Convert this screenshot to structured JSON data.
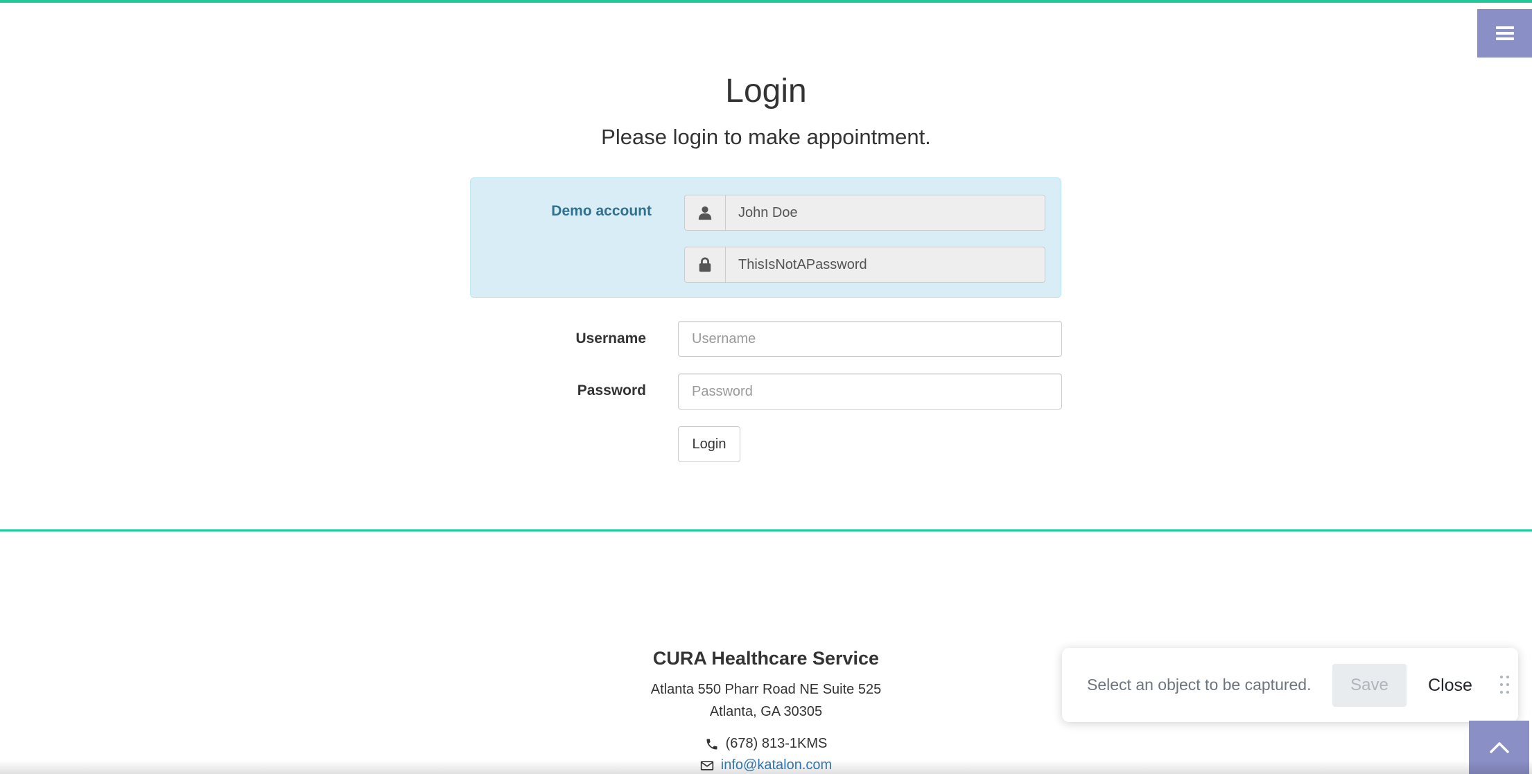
{
  "header": {
    "menu_icon": "bars-icon"
  },
  "login": {
    "title": "Login",
    "subtitle": "Please login to make appointment."
  },
  "demo": {
    "label": "Demo account",
    "username_icon": "user-icon",
    "username_value": "John Doe",
    "password_icon": "lock-icon",
    "password_value": "ThisIsNotAPassword"
  },
  "form": {
    "username_label": "Username",
    "username_placeholder": "Username",
    "password_label": "Password",
    "password_placeholder": "Password",
    "login_button": "Login"
  },
  "footer": {
    "company": "CURA Healthcare Service",
    "address_line1": "Atlanta 550 Pharr Road NE Suite 525",
    "address_line2": "Atlanta, GA 30305",
    "phone_icon": "phone-icon",
    "phone": "(678) 813-1KMS",
    "email_icon": "envelope-icon",
    "email": "info@katalon.com"
  },
  "capture_panel": {
    "message": "Select an object to be captured.",
    "save_label": "Save",
    "close_label": "Close",
    "drag_icon": "drag-handle-icon"
  },
  "back_to_top": {
    "icon": "chevron-up-icon"
  },
  "colors": {
    "accent_line": "#20c997",
    "menu_bg": "#8a8fc6",
    "demo_bg": "#d9edf7",
    "demo_text": "#31708f",
    "link": "#337ab7"
  }
}
